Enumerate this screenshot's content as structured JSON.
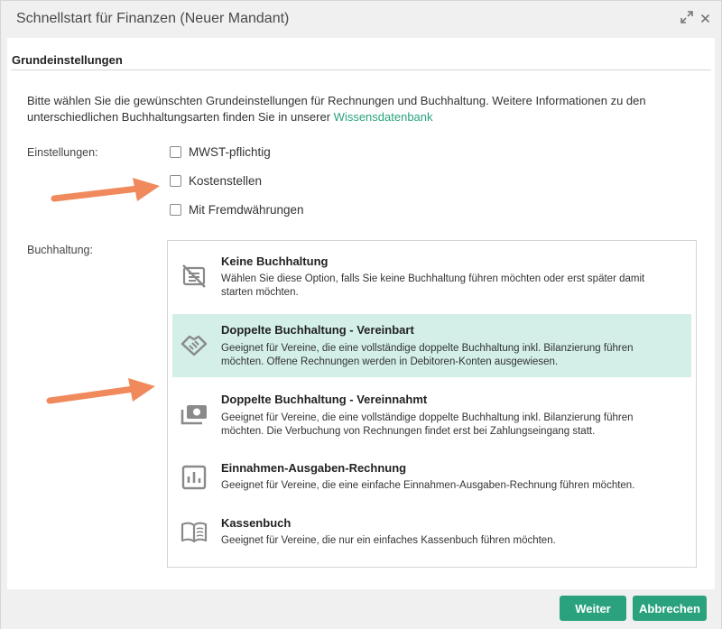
{
  "window": {
    "title": "Schnellstart für Finanzen (Neuer Mandant)",
    "expand_icon": "expand-icon",
    "close_icon": "close-icon"
  },
  "section": {
    "title": "Grundeinstellungen"
  },
  "intro": {
    "text": "Bitte wählen Sie die gewünschten Grundeinstellungen für Rechnungen und Buchhaltung. Weitere Informationen zu den unterschiedlichen Buchhaltungsarten finden Sie in unserer ",
    "link": "Wissensdatenbank"
  },
  "settings": {
    "label": "Einstellungen:",
    "options": [
      {
        "label": "MWST-pflichtig",
        "checked": false
      },
      {
        "label": "Kostenstellen",
        "checked": false
      },
      {
        "label": "Mit Fremdwährungen",
        "checked": false
      }
    ]
  },
  "accounting": {
    "label": "Buchhaltung:",
    "options": [
      {
        "title": "Keine Buchhaltung",
        "desc": "Wählen Sie diese Option, falls Sie keine Buchhaltung führen möchten oder erst später damit starten möchten.",
        "icon": "no-ledger-icon",
        "selected": false
      },
      {
        "title": "Doppelte Buchhaltung - Vereinbart",
        "desc": "Geeignet für Vereine, die eine vollständige doppelte Buchhaltung inkl. Bilanzierung führen möchten. Offene Rechnungen werden in Debitoren-Konten ausgewiesen.",
        "icon": "handshake-icon",
        "selected": true
      },
      {
        "title": "Doppelte Buchhaltung - Vereinnahmt",
        "desc": "Geeignet für Vereine, die eine vollständige doppelte Buchhaltung inkl. Bilanzierung führen möchten. Die Verbuchung von Rechnungen findet erst bei Zahlungseingang statt.",
        "icon": "cash-icon",
        "selected": false
      },
      {
        "title": "Einnahmen-Ausgaben-Rechnung",
        "desc": "Geeignet für Vereine, die eine einfache Einnahmen-Ausgaben-Rechnung führen möchten.",
        "icon": "bar-chart-icon",
        "selected": false
      },
      {
        "title": "Kassenbuch",
        "desc": "Geeignet für Vereine, die nur ein einfaches Kassenbuch führen möchten.",
        "icon": "book-icon",
        "selected": false
      }
    ]
  },
  "footer": {
    "next": "Weiter",
    "cancel": "Abbrechen"
  },
  "colors": {
    "accent": "#2aa27e",
    "selected_bg": "#d3efe8",
    "arrow": "#f08a5d"
  }
}
